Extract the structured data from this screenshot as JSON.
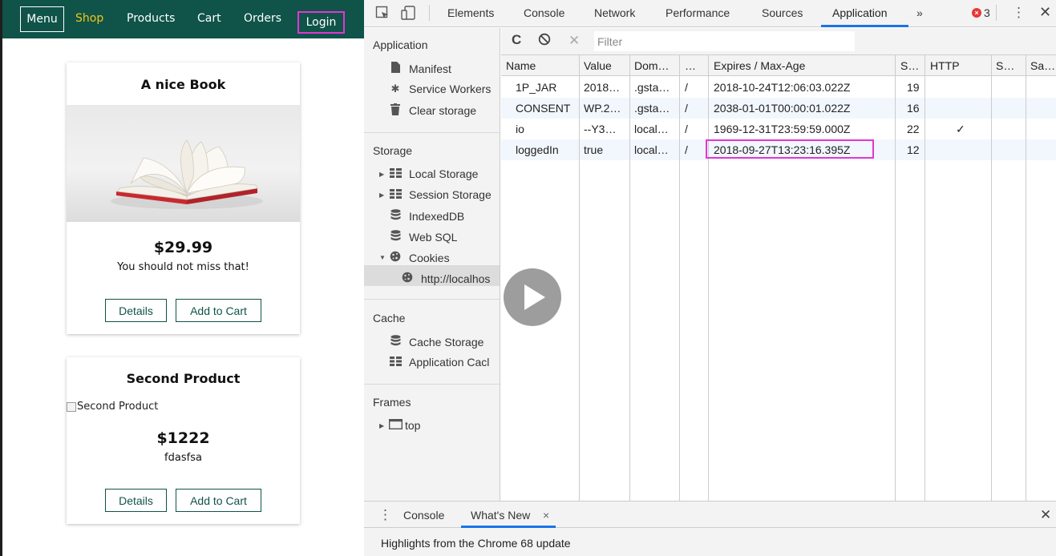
{
  "app": {
    "nav": {
      "menu": "Menu",
      "shop": "Shop",
      "products": "Products",
      "cart": "Cart",
      "orders": "Orders",
      "login": "Login"
    },
    "products": [
      {
        "title": "A nice Book",
        "price": "$29.99",
        "description": "You should not miss that!",
        "details_label": "Details",
        "add_to_cart_label": "Add to Cart"
      },
      {
        "title": "Second Product",
        "image_alt": "Second Product",
        "price": "$1222",
        "description": "fdasfsa",
        "details_label": "Details",
        "add_to_cart_label": "Add to Cart"
      }
    ]
  },
  "devtools": {
    "tabs": [
      "Elements",
      "Console",
      "Network",
      "Performance",
      "Sources",
      "Application",
      "»"
    ],
    "active_tab": "Application",
    "error_count": "3",
    "sidebar": {
      "application_header": "Application",
      "application_items": [
        "Manifest",
        "Service Workers",
        "Clear storage"
      ],
      "storage_header": "Storage",
      "storage_items": [
        "Local Storage",
        "Session Storage",
        "IndexedDB",
        "Web SQL",
        "Cookies"
      ],
      "cookie_origin": "http://localhos",
      "cache_header": "Cache",
      "cache_items": [
        "Cache Storage",
        "Application Cacl"
      ],
      "frames_header": "Frames",
      "frames_items": [
        "top"
      ]
    },
    "filter_placeholder": "Filter",
    "cookie_columns": [
      "Name",
      "Value",
      "Dom…",
      "…",
      "Expires / Max-Age",
      "S…",
      "HTTP",
      "S…",
      "Sa…"
    ],
    "cookies": [
      {
        "name": "1P_JAR",
        "value": "2018…",
        "domain": ".gsta…",
        "path": "/",
        "expires": "2018-10-24T12:06:03.022Z",
        "size": "19",
        "http": "",
        "secure": "",
        "samesite": ""
      },
      {
        "name": "CONSENT",
        "value": "WP.2…",
        "domain": ".gsta…",
        "path": "/",
        "expires": "2038-01-01T00:00:01.022Z",
        "size": "16",
        "http": "",
        "secure": "",
        "samesite": ""
      },
      {
        "name": "io",
        "value": "--Y3…",
        "domain": "local…",
        "path": "/",
        "expires": "1969-12-31T23:59:59.000Z",
        "size": "22",
        "http": "✓",
        "secure": "",
        "samesite": ""
      },
      {
        "name": "loggedIn",
        "value": "true",
        "domain": "local…",
        "path": "/",
        "expires": "2018-09-27T13:23:16.395Z",
        "size": "12",
        "http": "",
        "secure": "",
        "samesite": ""
      }
    ],
    "drawer": {
      "tabs": [
        "Console",
        "What's New"
      ],
      "active_tab": "What's New",
      "close_tab_glyph": "×",
      "message": "Highlights from the Chrome 68 update"
    }
  },
  "colors": {
    "nav_bg": "#0f5349",
    "nav_active": "#f5c518",
    "highlight_border": "#e535d2",
    "devtools_accent": "#1a73e8",
    "error_red": "#e53935"
  }
}
